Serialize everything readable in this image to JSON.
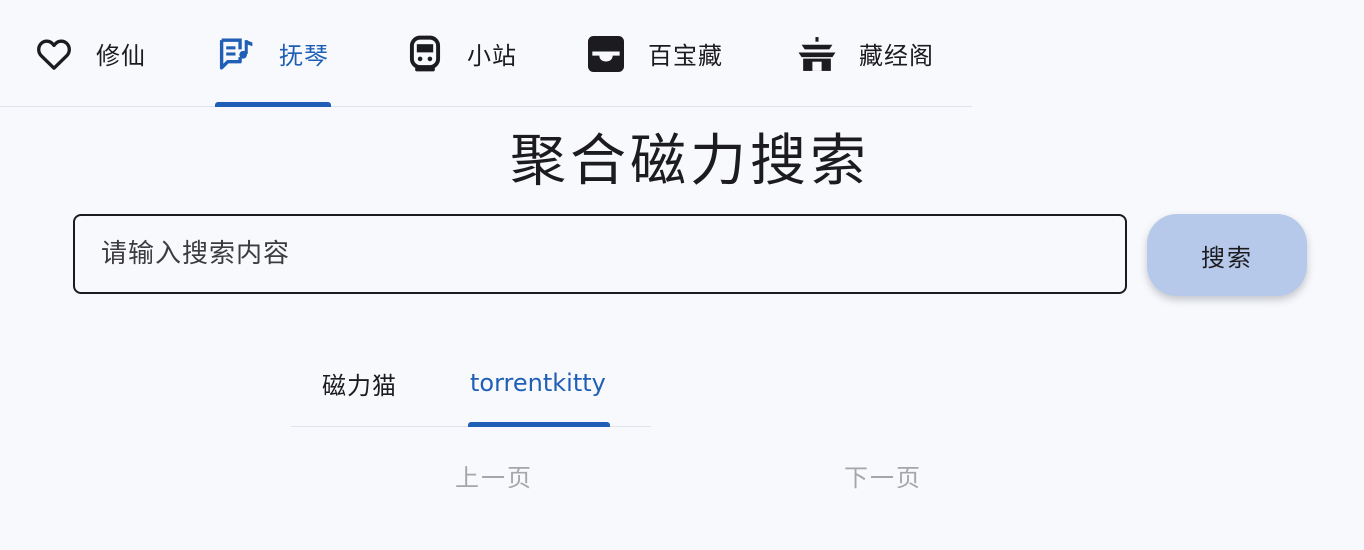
{
  "nav": {
    "items": [
      {
        "label": "修仙",
        "icon": "heart-icon",
        "active": false
      },
      {
        "label": "抚琴",
        "icon": "lyrics-note-icon",
        "active": true
      },
      {
        "label": "小站",
        "icon": "train-icon",
        "active": false
      },
      {
        "label": "百宝藏",
        "icon": "inbox-tray-icon",
        "active": false
      },
      {
        "label": "藏经阁",
        "icon": "temple-icon",
        "active": false
      }
    ],
    "accent_color": "#1f5fb5"
  },
  "title": "聚合磁力搜索",
  "search": {
    "placeholder": "请输入搜索内容",
    "value": "",
    "button_label": "搜索",
    "button_color": "#b7c9ea"
  },
  "source_tabs": [
    {
      "label": "磁力猫",
      "active": false
    },
    {
      "label": "torrentkitty",
      "active": true
    }
  ],
  "pagination": {
    "prev_label": "上一页",
    "next_label": "下一页",
    "disabled_color": "#a5a6aa"
  }
}
